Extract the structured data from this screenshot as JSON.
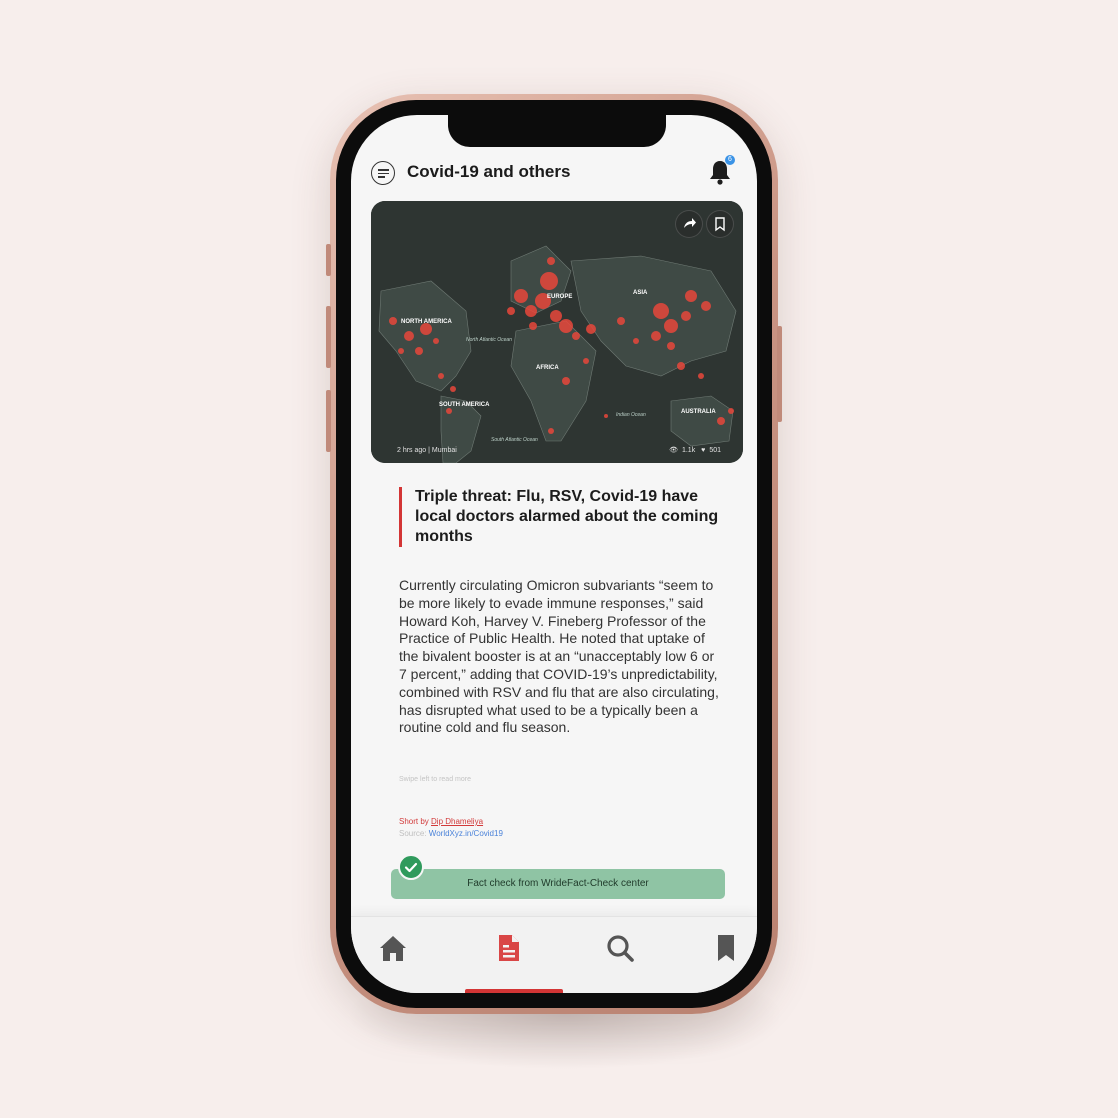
{
  "header": {
    "title": "Covid-19 and others",
    "notification_count": "6"
  },
  "hero": {
    "map_labels": {
      "europe": "EUROPE",
      "asia": "ASIA",
      "north_america": "NORTH AMERICA",
      "north_atlantic": "North Atlantic Ocean",
      "africa": "AFRICA",
      "south_america": "SOUTH AMERICA",
      "indian_ocean": "Indian Ocean",
      "south_atlantic": "South Atlantic Ocean",
      "australia": "AUSTRALIA"
    },
    "meta": "2 hrs ago | Mumbai",
    "views": "1.1k",
    "likes": "501"
  },
  "article": {
    "title": "Triple threat: Flu, RSV, Covid-19 have local doctors alarmed about the coming months",
    "body": "Currently circulating Omicron subvariants “seem to be more likely to evade immune responses,” said Howard Koh, Harvey V. Fineberg Professor of the Practice of Public Health. He noted that uptake of the bivalent booster is at an “unacceptably low 6 or 7 percent,” adding that COVID-19’s unpredictability, combined with RSV and flu that are also circulating, has disrupted what used to be a typically been a routine cold and flu season.",
    "swipe_hint": "Swipe left to read more",
    "byline_prefix": "Short by ",
    "author": "Dip Dhameliya",
    "source_prefix": "Source: ",
    "source_link": "WorldXyz.in/Covid19"
  },
  "fact_check": {
    "label": "Fact check from WrideFact-Check center"
  },
  "nav": {
    "items": [
      "home-icon",
      "news-icon",
      "search-icon",
      "bookmark-icon"
    ],
    "active": "news-icon"
  },
  "colors": {
    "accent": "#d33535",
    "fact_bg": "#8fc4a4",
    "fact_check": "#2f9a5c",
    "badge": "#3b93e6",
    "page_bg": "#f7eeec"
  }
}
